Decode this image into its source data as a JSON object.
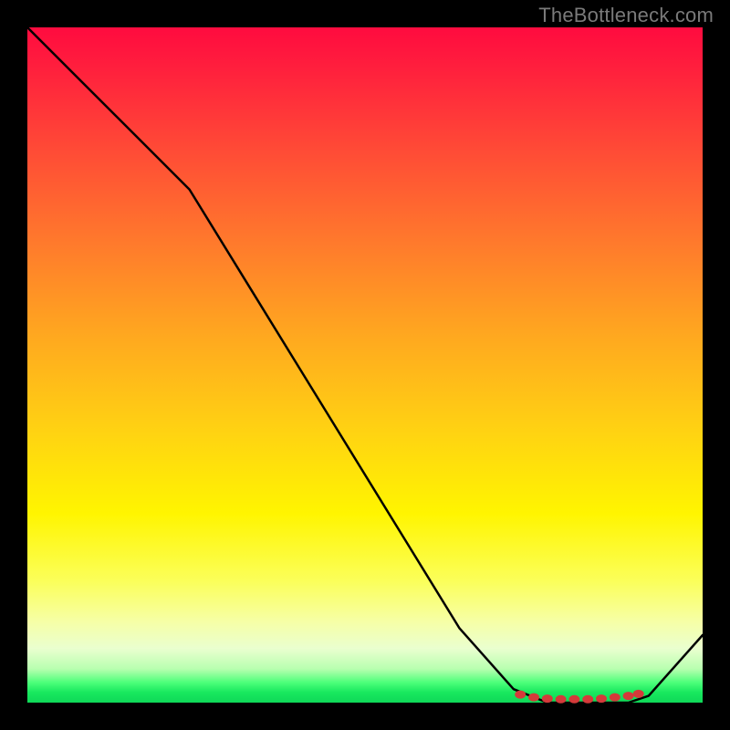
{
  "watermark": "TheBottleneck.com",
  "colors": {
    "bg": "#000000",
    "curve": "#000000",
    "marker": "#d43a3a",
    "gradient_stops": [
      "#ff0b3f",
      "#ff1f3d",
      "#ff4a36",
      "#ff7a2c",
      "#ffa91f",
      "#ffd312",
      "#fff500",
      "#fbff5a",
      "#f6ffa6",
      "#eaffcf",
      "#b8ffb0",
      "#4dff7a",
      "#18e85e",
      "#0fd858"
    ]
  },
  "chart_data": {
    "type": "line",
    "title": "",
    "xlabel": "",
    "ylabel": "",
    "x": [
      0,
      8,
      16,
      24,
      32,
      40,
      48,
      56,
      64,
      72,
      77,
      80,
      83,
      86,
      89,
      92,
      100
    ],
    "values": [
      100,
      92,
      84,
      76,
      63,
      50,
      37,
      24,
      11,
      2,
      0,
      0,
      0,
      0,
      0,
      1,
      10
    ],
    "xlim": [
      0,
      100
    ],
    "ylim": [
      0,
      100
    ],
    "marker_x": [
      73,
      75,
      77,
      79,
      81,
      83,
      85,
      87,
      89,
      90.5
    ],
    "marker_y": [
      1.2,
      0.8,
      0.6,
      0.5,
      0.5,
      0.5,
      0.6,
      0.8,
      1.0,
      1.3
    ]
  }
}
